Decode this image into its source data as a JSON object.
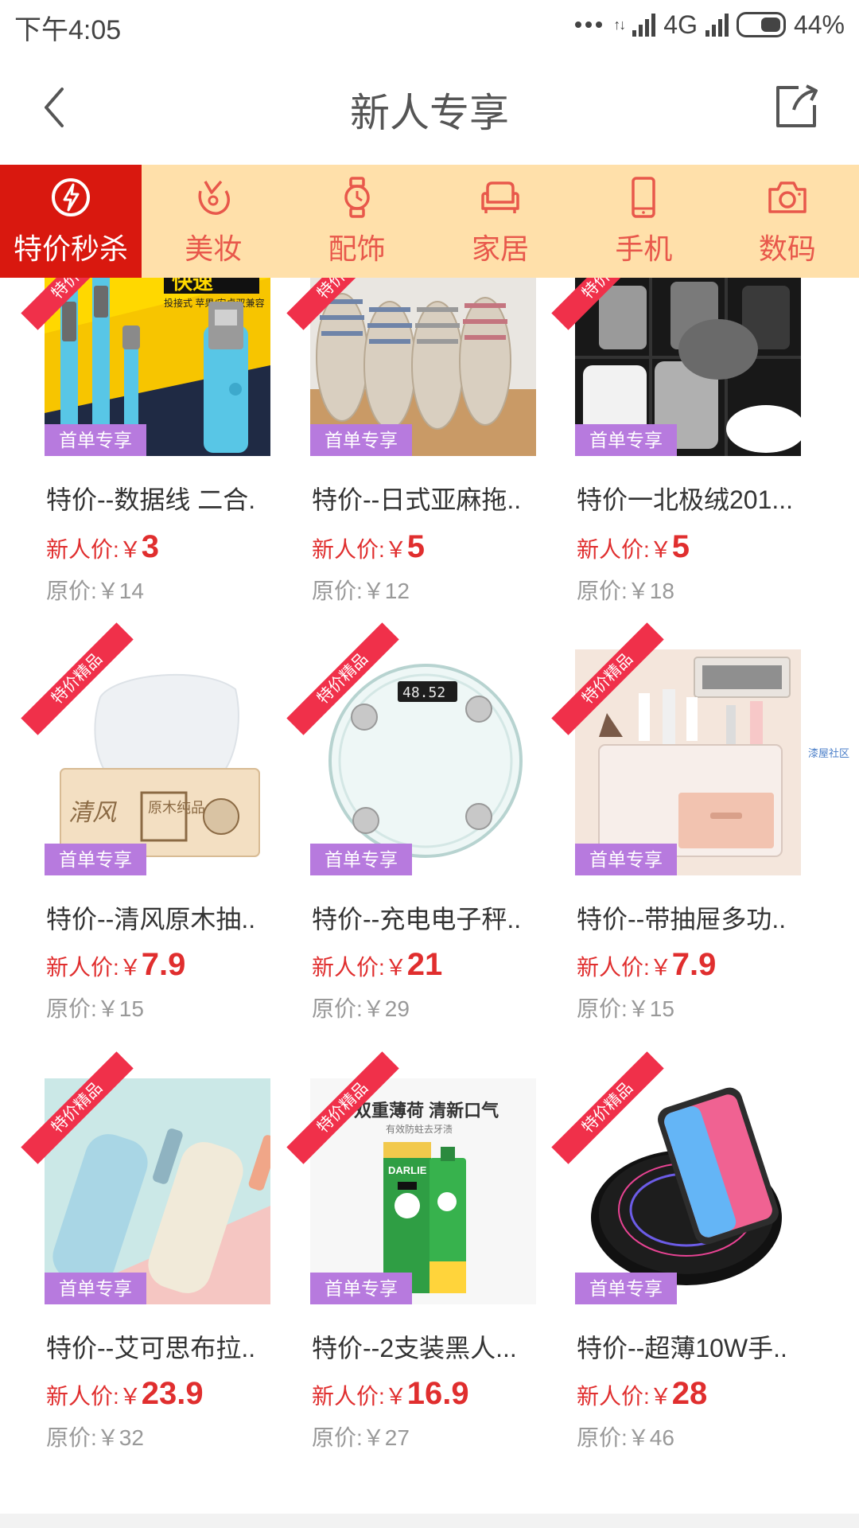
{
  "status_bar": {
    "time": "下午4:05",
    "network": "4G",
    "battery": "44%"
  },
  "header": {
    "title": "新人专享"
  },
  "categories": [
    {
      "label": "特价秒杀",
      "icon": "flash-icon",
      "active": true
    },
    {
      "label": "美妆",
      "icon": "makeup-icon",
      "active": false
    },
    {
      "label": "配饰",
      "icon": "watch-icon",
      "active": false
    },
    {
      "label": "家居",
      "icon": "sofa-icon",
      "active": false
    },
    {
      "label": "手机",
      "icon": "phone-icon",
      "active": false
    },
    {
      "label": "数码",
      "icon": "camera-icon",
      "active": false
    }
  ],
  "labels": {
    "ribbon": "特价精品",
    "badge": "首单专享",
    "new_price_prefix": "新人价:",
    "old_price_prefix": "原价:",
    "currency": "￥"
  },
  "products": [
    {
      "title": "特价--数据线 二合.",
      "new_price": "3",
      "old_price": "14"
    },
    {
      "title": "特价--日式亚麻拖..",
      "new_price": "5",
      "old_price": "12"
    },
    {
      "title": "特价一北极绒201...",
      "new_price": "5",
      "old_price": "18"
    },
    {
      "title": "特价--清风原木抽..",
      "new_price": "7.9",
      "old_price": "15"
    },
    {
      "title": "特价--充电电子秤..",
      "new_price": "21",
      "old_price": "29"
    },
    {
      "title": "特价--带抽屉多功..",
      "new_price": "7.9",
      "old_price": "15"
    },
    {
      "title": "特价--艾可思布拉..",
      "new_price": "23.9",
      "old_price": "32"
    },
    {
      "title": "特价--2支装黑人...",
      "new_price": "16.9",
      "old_price": "27"
    },
    {
      "title": "特价--超薄10W手..",
      "new_price": "28",
      "old_price": "46"
    }
  ],
  "product_images": {
    "tissue_brand": "清风",
    "tissue_box_text": "原木纯品",
    "scale_display": "48.52",
    "toothpaste_banner": "双重薄荷 清新口气",
    "toothpaste_sub": "有效防蛀去牙渍",
    "toothpaste_brand": "DARLIE",
    "cable_banner": "快速",
    "cable_sub": "投接式 苹果/安卓双兼容"
  },
  "watermark": "漆屋社区",
  "colors": {
    "accent_red": "#d9180f",
    "category_bg": "#ffe0aa",
    "badge_purple": "#b77ade",
    "price_red": "#e02e2e"
  }
}
